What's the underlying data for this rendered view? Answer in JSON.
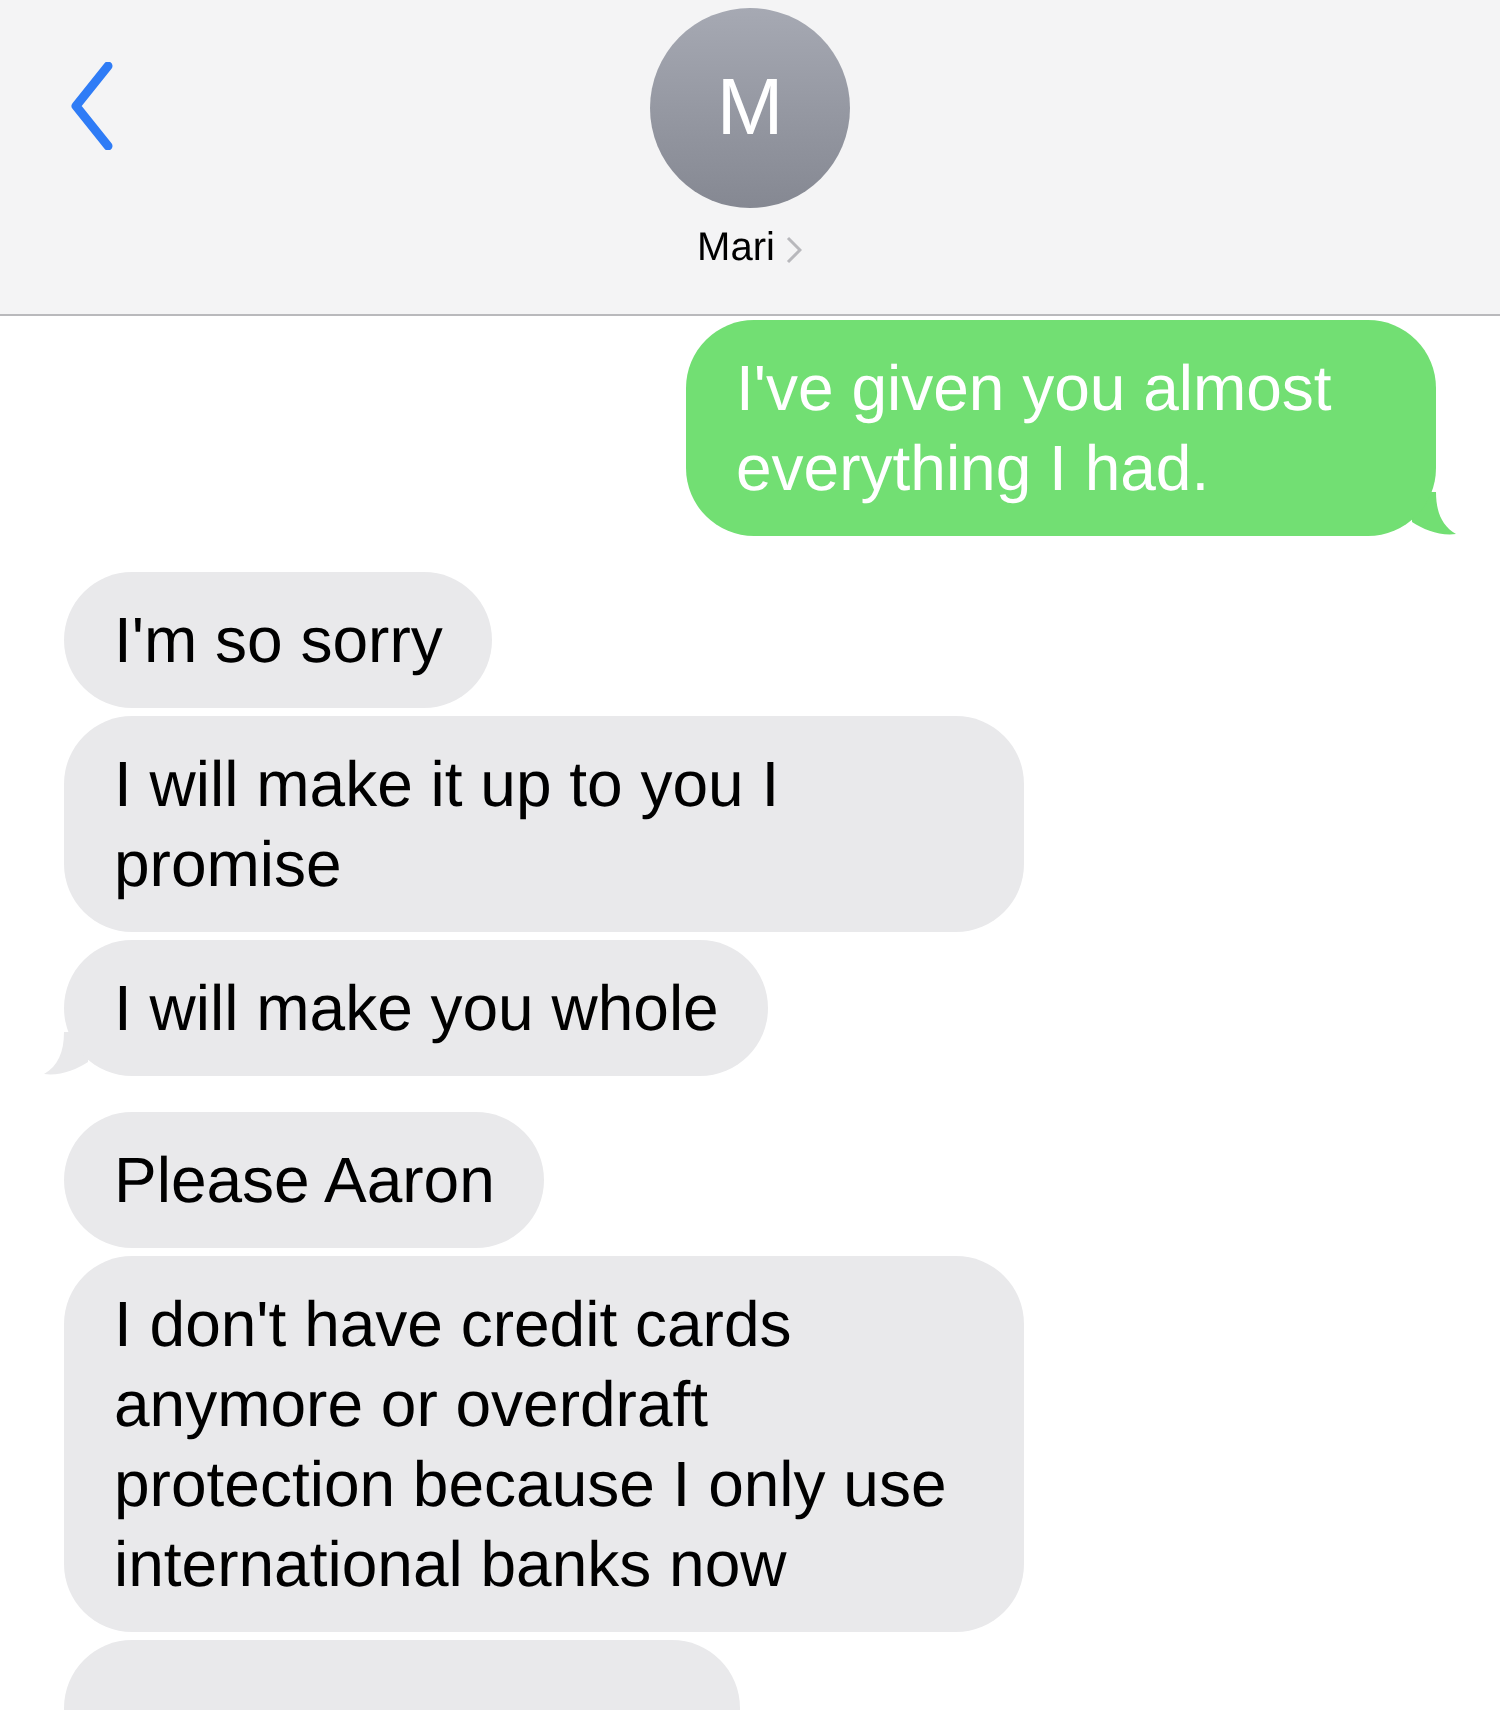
{
  "header": {
    "avatar_initial": "M",
    "contact_name": "Mari"
  },
  "messages": [
    {
      "kind": "sent",
      "text": "I've given you almost everything I had.",
      "tail": true
    },
    {
      "kind": "received",
      "text": "I'm so sorry",
      "tail": false
    },
    {
      "kind": "received",
      "text": "I will make it up to you I promise",
      "tail": false
    },
    {
      "kind": "received",
      "text": "I will make you whole",
      "tail": true
    },
    {
      "kind": "received",
      "text": "Please Aaron",
      "tail": false
    },
    {
      "kind": "received",
      "text": "I don't have credit cards anymore or overdraft protection because I only use international banks now",
      "tail": false
    },
    {
      "kind": "received",
      "tail": false
    }
  ]
}
